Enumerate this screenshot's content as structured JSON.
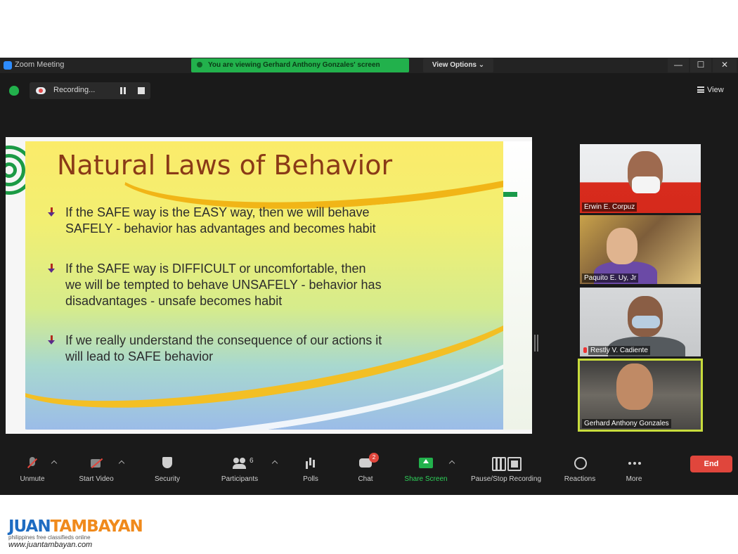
{
  "window": {
    "title": "Zoom Meeting",
    "viewing_banner": "You are viewing Gerhard Anthony Gonzales' screen",
    "view_options": "View Options ⌄",
    "minimize": "—",
    "maximize": "☐",
    "close": "✕"
  },
  "topbar": {
    "recording_label": "Recording...",
    "view_label": "View"
  },
  "slide": {
    "title": "Natural Laws of Behavior",
    "bullets": [
      "If the SAFE way is the EASY way, then we will behave\nSAFELY - behavior has advantages and becomes habit",
      "If the SAFE way is DIFFICULT or uncomfortable, then\nwe will be tempted to behave UNSAFELY -  behavior has\ndisadvantages - unsafe becomes habit",
      "If we really understand the consequence of our actions it\nwill lead to SAFE behavior"
    ]
  },
  "participants": [
    {
      "name": "Erwin E. Corpuz"
    },
    {
      "name": "Paquito E. Uy, Jr"
    },
    {
      "name": "Restly V. Cadiente"
    },
    {
      "name": "Gerhard Anthony Gonzales"
    }
  ],
  "toolbar": {
    "unmute": "Unmute",
    "start_video": "Start Video",
    "security": "Security",
    "participants": "Participants",
    "participants_count": "6",
    "polls": "Polls",
    "chat": "Chat",
    "chat_badge": "2",
    "share_screen": "Share Screen",
    "pause_stop_recording": "Pause/Stop Recording",
    "reactions": "Reactions",
    "more": "More",
    "end": "End"
  },
  "watermark": {
    "brand_part1": "JUAN",
    "brand_part2": "TAMBAYAN",
    "tagline": "philippines                free classifieds online",
    "url": "www.juantambayan.com"
  },
  "colors": {
    "accent_green": "#22b14c",
    "end_red": "#e0463c",
    "slide_title": "#8a3a17"
  }
}
